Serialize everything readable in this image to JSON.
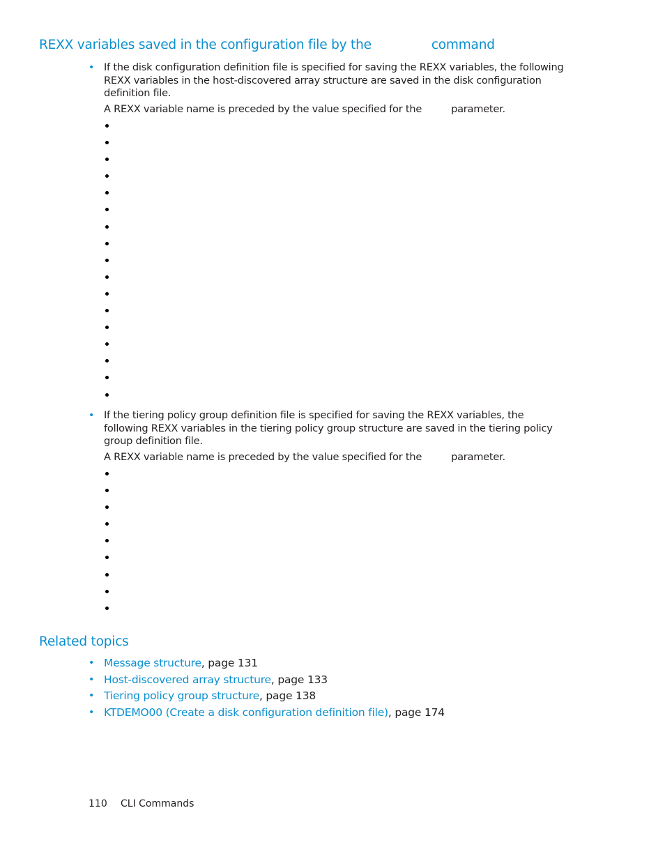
{
  "heading": {
    "part1": "REXX variables saved in the configuration file by the",
    "part2": "command"
  },
  "section_disk": {
    "text": "If the disk configuration definition file is specified for saving the REXX variables, the following REXX variables in the host-discovered array structure are saved in the disk configuration definition file.",
    "note_part1": "A REXX variable name is preceded by the value specified for the",
    "note_part2": "parameter.",
    "sub_items": [
      "",
      "",
      "",
      "",
      "",
      "",
      "",
      "",
      "",
      "",
      "",
      "",
      "",
      "",
      "",
      "",
      ""
    ]
  },
  "section_tiering": {
    "text": "If the tiering policy group definition file is specified for saving the REXX variables, the following REXX variables in the tiering policy group structure are saved in the tiering policy group definition file.",
    "note_part1": "A REXX variable name is preceded by the value specified for the",
    "note_part2": "parameter.",
    "sub_items": [
      "",
      "",
      "",
      "",
      "",
      "",
      "",
      "",
      ""
    ]
  },
  "related_topics": {
    "title": "Related topics",
    "items": [
      {
        "link": "Message structure",
        "suffix": ", page 131"
      },
      {
        "link": "Host-discovered array structure",
        "suffix": ", page 133"
      },
      {
        "link": "Tiering policy group structure",
        "suffix": ", page 138"
      },
      {
        "link": "KTDEMO00 (Create a disk configuration definition file)",
        "suffix": ", page 174"
      }
    ]
  },
  "footer": {
    "page_number": "110",
    "section": "CLI Commands"
  },
  "colors": {
    "accent": "#0a8fd0",
    "text": "#231f20"
  }
}
